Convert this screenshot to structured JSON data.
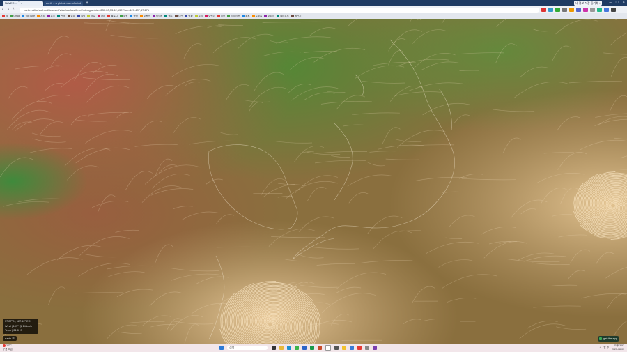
{
  "browser": {
    "tabs": [
      {
        "label": "NAVER...   ＾  ×",
        "active": true
      },
      {
        "label": "earth :: a global map of wind",
        "active": false
      }
    ],
    "url": "earth.nullschool.net/#current/wind/surface/level/orthographic=-230.00,33.42,1507/loc=127.487,37.271",
    "profile": "내 정보 저장 동기화 ↓"
  },
  "bookmarks": [
    "앱",
    "Gmail",
    "YouTube",
    "지도",
    "뉴스",
    "번역",
    "날씨",
    "쇼핑",
    "메일",
    "카페",
    "블로그",
    "쇼핑",
    "증권",
    "부동산",
    "지식iN",
    "웹툰",
    "사전",
    "영화",
    "뮤직",
    "캘린더",
    "메모",
    "드라이브",
    "포토",
    "주소록",
    "오피스",
    "클라우드",
    "계산기"
  ],
  "map_overlay": {
    "location": "37.27° N, 127.49° E  ✕",
    "wind": "Wind | 107° @ 14  km/h",
    "temp": "Temp | 21.8  °C",
    "earth_button": "earth  ☰",
    "get_app": "get the app"
  },
  "taskbar": {
    "weather_temp": "27°C",
    "weather_desc": "구름 조금",
    "search_placeholder": "검색",
    "time": "오후 3:52",
    "date": "2023-08-09",
    "lang": "한  ⊕"
  },
  "colors": {
    "map_green": "#4e8a35",
    "map_red": "#b25a47",
    "map_tan": "#c9a879",
    "streamline": "#f3e0bd",
    "tabbar": "#1f3b63"
  }
}
